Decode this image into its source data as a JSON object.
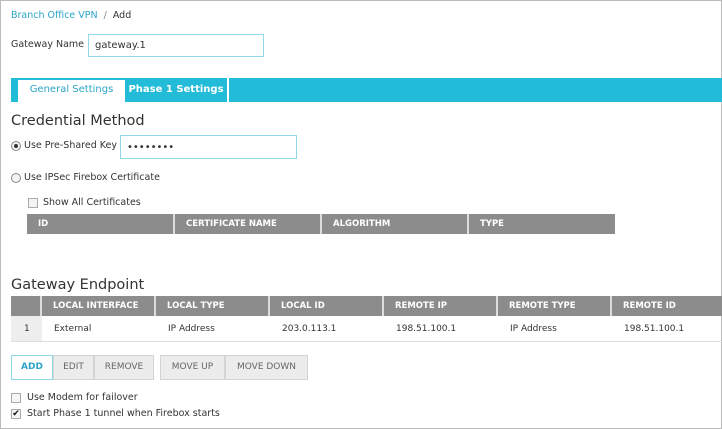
{
  "breadcrumb": {
    "parent": "Branch Office VPN",
    "current": "Add"
  },
  "gateway_name": {
    "label": "Gateway Name",
    "value": "gateway.1"
  },
  "tabs": [
    {
      "label": "General Settings",
      "active": true
    },
    {
      "label": "Phase 1 Settings",
      "active": false
    }
  ],
  "credential": {
    "heading": "Credential Method",
    "psk_label": "Use Pre-Shared Key",
    "psk_value": "••••••••",
    "psk_selected": true,
    "cert_label": "Use IPSec Firebox Certificate",
    "show_all_label": "Show All Certificates",
    "cert_columns": [
      "ID",
      "CERTIFICATE NAME",
      "ALGORITHM",
      "TYPE"
    ]
  },
  "endpoint": {
    "heading": "Gateway Endpoint",
    "columns": [
      "",
      "LOCAL INTERFACE",
      "LOCAL TYPE",
      "LOCAL ID",
      "REMOTE IP",
      "REMOTE TYPE",
      "REMOTE ID"
    ],
    "rows": [
      [
        "1",
        "External",
        "IP Address",
        "203.0.113.1",
        "198.51.100.1",
        "IP Address",
        "198.51.100.1"
      ]
    ]
  },
  "buttons": {
    "add": "ADD",
    "edit": "EDIT",
    "remove": "REMOVE",
    "move_up": "MOVE UP",
    "move_down": "MOVE DOWN"
  },
  "options": {
    "modem": {
      "label": "Use Modem for failover",
      "checked": false
    },
    "start_phase1": {
      "label": "Start Phase 1 tunnel when Firebox starts",
      "checked": true
    }
  }
}
